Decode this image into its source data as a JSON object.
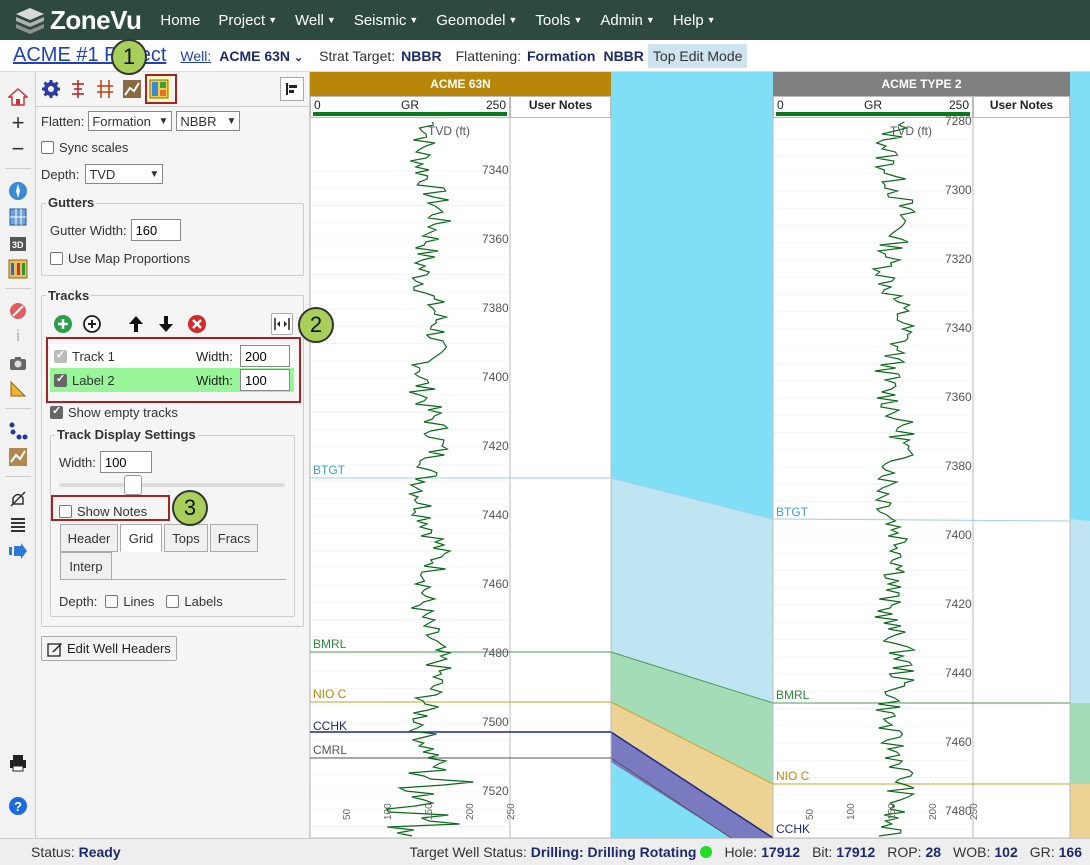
{
  "nav": {
    "logo": "ZoneVu",
    "items": [
      {
        "label": "Home",
        "caret": false
      },
      {
        "label": "Project",
        "caret": true
      },
      {
        "label": "Well",
        "caret": true
      },
      {
        "label": "Seismic",
        "caret": true
      },
      {
        "label": "Geomodel",
        "caret": true
      },
      {
        "label": "Tools",
        "caret": true
      },
      {
        "label": "Admin",
        "caret": true
      },
      {
        "label": "Help",
        "caret": true
      }
    ]
  },
  "subheader": {
    "project_title": "ACME #1 Project",
    "well_label": "Well:",
    "well_value": "ACME 63N",
    "strat_label": "Strat Target:",
    "strat_value": "NBBR",
    "flat_label": "Flattening:",
    "flat_value1": "Formation",
    "flat_value2": "NBBR",
    "mode": "Top Edit Mode"
  },
  "panel": {
    "flatten_label": "Flatten:",
    "flatten_value": "Formation",
    "flatten_target": "NBBR",
    "sync_scales": "Sync scales",
    "depth_label": "Depth:",
    "depth_value": "TVD",
    "gutters_title": "Gutters",
    "gutter_width_label": "Gutter Width:",
    "gutter_width_value": "160",
    "use_map_proportions": "Use Map Proportions",
    "tracks_title": "Tracks",
    "tracks": [
      {
        "name": "Track 1",
        "width_label": "Width:",
        "width": "200",
        "checked": true
      },
      {
        "name": "Label 2",
        "width_label": "Width:",
        "width": "100",
        "checked": true
      }
    ],
    "show_empty_tracks": "Show empty tracks",
    "tds_title": "Track Display Settings",
    "tds_width_label": "Width:",
    "tds_width_value": "100",
    "show_notes": "Show Notes",
    "tabs": [
      "Header",
      "Grid",
      "Tops",
      "Fracs",
      "Interp"
    ],
    "depth_opts_label": "Depth:",
    "lines_label": "Lines",
    "labels_label": "Labels",
    "edit_headers": "Edit Well Headers"
  },
  "badges": [
    "1",
    "2",
    "3"
  ],
  "wells": [
    {
      "name": "ACME 63N",
      "header_color": "#b8860b",
      "gr_min": "0",
      "gr_label": "GR",
      "gr_max": "250",
      "notes_label": "User Notes",
      "depth_axis_label": "TVD (ft)",
      "depths": [
        "7340",
        "7360",
        "7380",
        "7400",
        "7420",
        "7440",
        "7460",
        "7480",
        "7500",
        "7520"
      ],
      "tops": [
        {
          "name": "BTGT",
          "color": "#3aa0d0"
        },
        {
          "name": "BMRL",
          "color": "#2a8a3a"
        },
        {
          "name": "NIO C",
          "color": "#b8860b"
        },
        {
          "name": "CCHK",
          "color": "#1a2a8a"
        },
        {
          "name": "CMRL",
          "color": "#555555"
        }
      ],
      "bottom_scale": [
        "50",
        "100",
        "150",
        "200",
        "250"
      ]
    },
    {
      "name": "ACME TYPE 2",
      "header_color": "#808080",
      "gr_min": "0",
      "gr_label": "GR",
      "gr_max": "250",
      "notes_label": "User Notes",
      "depth_axis_label": "TVD (ft)",
      "depths": [
        "7280",
        "7300",
        "7320",
        "7340",
        "7360",
        "7380",
        "7400",
        "7420",
        "7440",
        "7460",
        "7480"
      ],
      "tops": [
        {
          "name": "BTGT",
          "color": "#3aa0d0"
        },
        {
          "name": "BMRL",
          "color": "#2a8a3a"
        },
        {
          "name": "NIO C",
          "color": "#b8860b"
        },
        {
          "name": "CCHK",
          "color": "#1a2a8a"
        }
      ],
      "bottom_scale": [
        "50",
        "100",
        "150",
        "200",
        "250"
      ]
    }
  ],
  "status": {
    "status_label": "Status:",
    "status_value": "Ready",
    "target_label": "Target Well Status:",
    "target_value": "Drilling: Drilling Rotating",
    "hole_label": "Hole:",
    "hole_value": "17912",
    "bit_label": "Bit:",
    "bit_value": "17912",
    "rop_label": "ROP:",
    "rop_value": "28",
    "wob_label": "WOB:",
    "wob_value": "102",
    "gr_label": "GR:",
    "gr_value": "166"
  },
  "colors": {
    "nav_bg": "#2e4a40",
    "accent_green": "#a8cf5a",
    "highlight_row": "#98f598",
    "formation_bg": "#7fdff7"
  }
}
